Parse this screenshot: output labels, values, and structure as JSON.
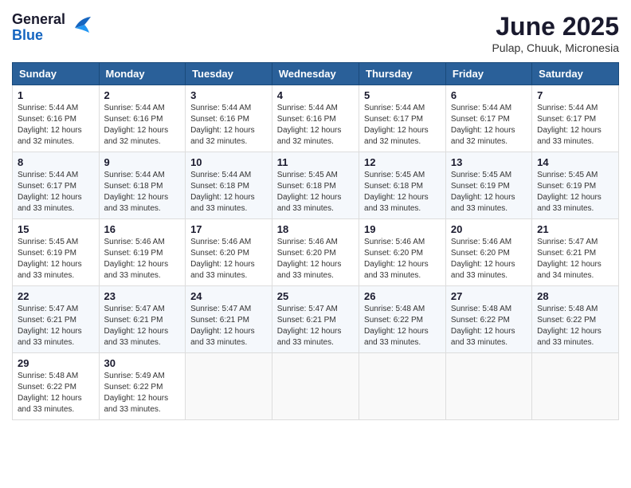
{
  "logo": {
    "general": "General",
    "blue": "Blue"
  },
  "title": "June 2025",
  "location": "Pulap, Chuuk, Micronesia",
  "days_of_week": [
    "Sunday",
    "Monday",
    "Tuesday",
    "Wednesday",
    "Thursday",
    "Friday",
    "Saturday"
  ],
  "weeks": [
    [
      {
        "day": "1",
        "sunrise": "5:44 AM",
        "sunset": "6:16 PM",
        "daylight": "12 hours and 32 minutes."
      },
      {
        "day": "2",
        "sunrise": "5:44 AM",
        "sunset": "6:16 PM",
        "daylight": "12 hours and 32 minutes."
      },
      {
        "day": "3",
        "sunrise": "5:44 AM",
        "sunset": "6:16 PM",
        "daylight": "12 hours and 32 minutes."
      },
      {
        "day": "4",
        "sunrise": "5:44 AM",
        "sunset": "6:16 PM",
        "daylight": "12 hours and 32 minutes."
      },
      {
        "day": "5",
        "sunrise": "5:44 AM",
        "sunset": "6:17 PM",
        "daylight": "12 hours and 32 minutes."
      },
      {
        "day": "6",
        "sunrise": "5:44 AM",
        "sunset": "6:17 PM",
        "daylight": "12 hours and 32 minutes."
      },
      {
        "day": "7",
        "sunrise": "5:44 AM",
        "sunset": "6:17 PM",
        "daylight": "12 hours and 33 minutes."
      }
    ],
    [
      {
        "day": "8",
        "sunrise": "5:44 AM",
        "sunset": "6:17 PM",
        "daylight": "12 hours and 33 minutes."
      },
      {
        "day": "9",
        "sunrise": "5:44 AM",
        "sunset": "6:18 PM",
        "daylight": "12 hours and 33 minutes."
      },
      {
        "day": "10",
        "sunrise": "5:44 AM",
        "sunset": "6:18 PM",
        "daylight": "12 hours and 33 minutes."
      },
      {
        "day": "11",
        "sunrise": "5:45 AM",
        "sunset": "6:18 PM",
        "daylight": "12 hours and 33 minutes."
      },
      {
        "day": "12",
        "sunrise": "5:45 AM",
        "sunset": "6:18 PM",
        "daylight": "12 hours and 33 minutes."
      },
      {
        "day": "13",
        "sunrise": "5:45 AM",
        "sunset": "6:19 PM",
        "daylight": "12 hours and 33 minutes."
      },
      {
        "day": "14",
        "sunrise": "5:45 AM",
        "sunset": "6:19 PM",
        "daylight": "12 hours and 33 minutes."
      }
    ],
    [
      {
        "day": "15",
        "sunrise": "5:45 AM",
        "sunset": "6:19 PM",
        "daylight": "12 hours and 33 minutes."
      },
      {
        "day": "16",
        "sunrise": "5:46 AM",
        "sunset": "6:19 PM",
        "daylight": "12 hours and 33 minutes."
      },
      {
        "day": "17",
        "sunrise": "5:46 AM",
        "sunset": "6:20 PM",
        "daylight": "12 hours and 33 minutes."
      },
      {
        "day": "18",
        "sunrise": "5:46 AM",
        "sunset": "6:20 PM",
        "daylight": "12 hours and 33 minutes."
      },
      {
        "day": "19",
        "sunrise": "5:46 AM",
        "sunset": "6:20 PM",
        "daylight": "12 hours and 33 minutes."
      },
      {
        "day": "20",
        "sunrise": "5:46 AM",
        "sunset": "6:20 PM",
        "daylight": "12 hours and 33 minutes."
      },
      {
        "day": "21",
        "sunrise": "5:47 AM",
        "sunset": "6:21 PM",
        "daylight": "12 hours and 34 minutes."
      }
    ],
    [
      {
        "day": "22",
        "sunrise": "5:47 AM",
        "sunset": "6:21 PM",
        "daylight": "12 hours and 33 minutes."
      },
      {
        "day": "23",
        "sunrise": "5:47 AM",
        "sunset": "6:21 PM",
        "daylight": "12 hours and 33 minutes."
      },
      {
        "day": "24",
        "sunrise": "5:47 AM",
        "sunset": "6:21 PM",
        "daylight": "12 hours and 33 minutes."
      },
      {
        "day": "25",
        "sunrise": "5:47 AM",
        "sunset": "6:21 PM",
        "daylight": "12 hours and 33 minutes."
      },
      {
        "day": "26",
        "sunrise": "5:48 AM",
        "sunset": "6:22 PM",
        "daylight": "12 hours and 33 minutes."
      },
      {
        "day": "27",
        "sunrise": "5:48 AM",
        "sunset": "6:22 PM",
        "daylight": "12 hours and 33 minutes."
      },
      {
        "day": "28",
        "sunrise": "5:48 AM",
        "sunset": "6:22 PM",
        "daylight": "12 hours and 33 minutes."
      }
    ],
    [
      {
        "day": "29",
        "sunrise": "5:48 AM",
        "sunset": "6:22 PM",
        "daylight": "12 hours and 33 minutes."
      },
      {
        "day": "30",
        "sunrise": "5:49 AM",
        "sunset": "6:22 PM",
        "daylight": "12 hours and 33 minutes."
      },
      null,
      null,
      null,
      null,
      null
    ]
  ],
  "labels": {
    "sunrise": "Sunrise:",
    "sunset": "Sunset:",
    "daylight": "Daylight: 12 hours"
  }
}
